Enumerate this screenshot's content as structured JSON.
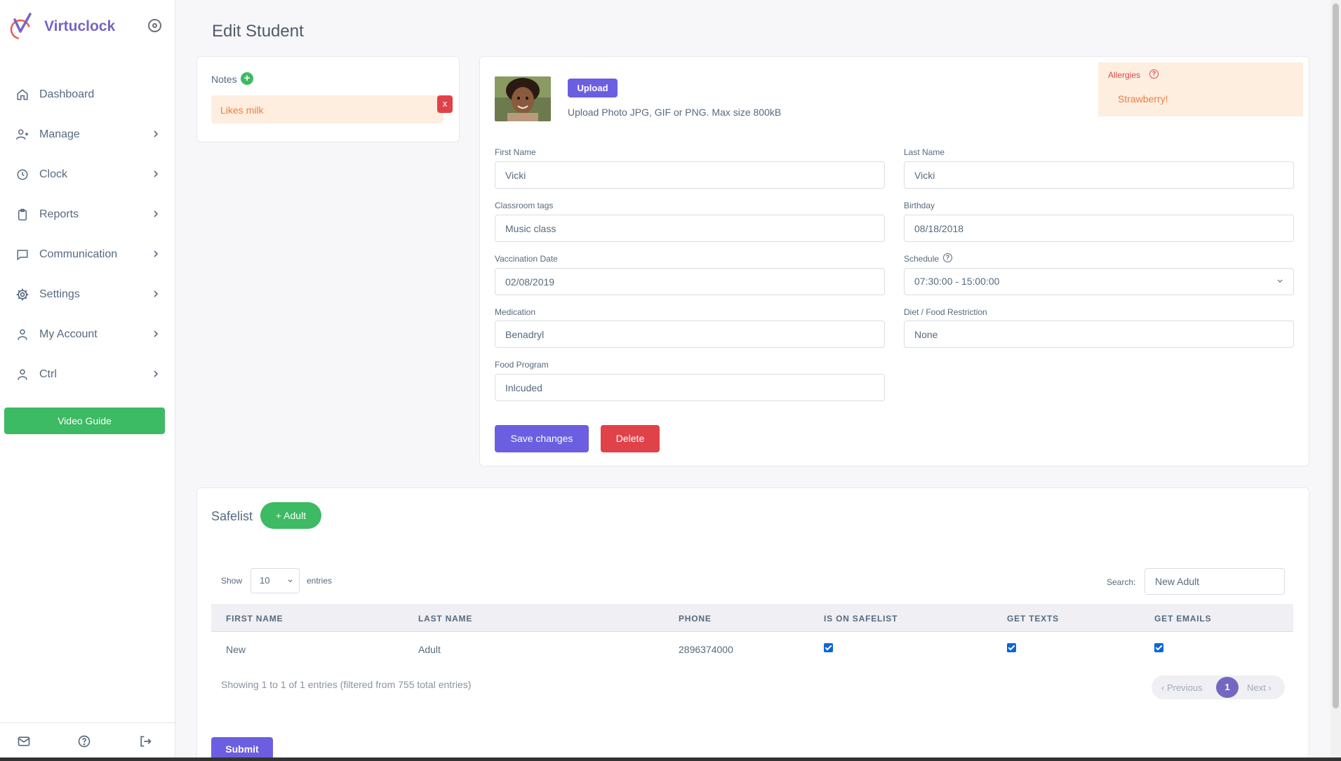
{
  "app": {
    "name": "Virtuclock"
  },
  "sidebar": {
    "items": [
      {
        "label": "Dashboard",
        "icon": "home-icon",
        "has_submenu": false
      },
      {
        "label": "Manage",
        "icon": "user-plus-icon",
        "has_submenu": true
      },
      {
        "label": "Clock",
        "icon": "clock-icon",
        "has_submenu": true
      },
      {
        "label": "Reports",
        "icon": "clipboard-icon",
        "has_submenu": true
      },
      {
        "label": "Communication",
        "icon": "chat-icon",
        "has_submenu": true
      },
      {
        "label": "Settings",
        "icon": "gear-icon",
        "has_submenu": true
      },
      {
        "label": "My Account",
        "icon": "user-icon",
        "has_submenu": true
      },
      {
        "label": "Ctrl",
        "icon": "user-icon",
        "has_submenu": true
      }
    ],
    "video_guide": "Video Guide",
    "footer_icons": [
      "mail-icon",
      "help-icon",
      "logout-icon"
    ]
  },
  "page": {
    "title": "Edit Student"
  },
  "notes": {
    "label": "Notes",
    "add_symbol": "+",
    "items": [
      {
        "text": "Likes milk",
        "delete_label": "x"
      }
    ]
  },
  "student_form": {
    "upload_button": "Upload",
    "upload_hint": "Upload Photo JPG, GIF or PNG. Max size 800kB",
    "allergies": {
      "label": "Allergies",
      "help_symbol": "?",
      "value": "Strawberry!"
    },
    "fields": {
      "first_name": {
        "label": "First Name",
        "value": "Vicki"
      },
      "last_name": {
        "label": "Last Name",
        "value": "Vicki"
      },
      "classroom_tags": {
        "label": "Classroom tags",
        "value": "Music class"
      },
      "birthday": {
        "label": "Birthday",
        "value": "08/18/2018"
      },
      "vaccination_date": {
        "label": "Vaccination Date",
        "value": "02/08/2019"
      },
      "schedule": {
        "label": "Schedule",
        "help_symbol": "?",
        "value": "07:30:00 - 15:00:00"
      },
      "medication": {
        "label": "Medication",
        "value": "Benadryl"
      },
      "diet": {
        "label": "Diet / Food Restriction",
        "value": "None"
      },
      "food_program": {
        "label": "Food Program",
        "value": "Inlcuded"
      }
    },
    "save_button": "Save changes",
    "delete_button": "Delete"
  },
  "safelist": {
    "title": "Safelist",
    "add_button": "+ Adult",
    "show_label": "Show",
    "entries_value": "10",
    "entries_label": "entries",
    "search_label": "Search:",
    "search_value": "New Adult",
    "columns": [
      "FIRST NAME",
      "LAST NAME",
      "PHONE",
      "IS ON SAFELIST",
      "GET TEXTS",
      "GET EMAILS"
    ],
    "rows": [
      {
        "first_name": "New",
        "last_name": "Adult",
        "phone": "2896374000",
        "is_on_safelist": true,
        "get_texts": true,
        "get_emails": true
      }
    ],
    "info": "Showing 1 to 1 of 1 entries (filtered from 755 total entries)",
    "pagination": {
      "previous": "Previous",
      "current": "1",
      "next": "Next"
    },
    "submit_button": "Submit"
  },
  "colors": {
    "brand": "#7367c2",
    "primary_button": "#6b5ee0",
    "success": "#3cba64",
    "danger": "#e0424a",
    "note_bg": "#fdeee0",
    "note_text": "#ee7e3c"
  }
}
